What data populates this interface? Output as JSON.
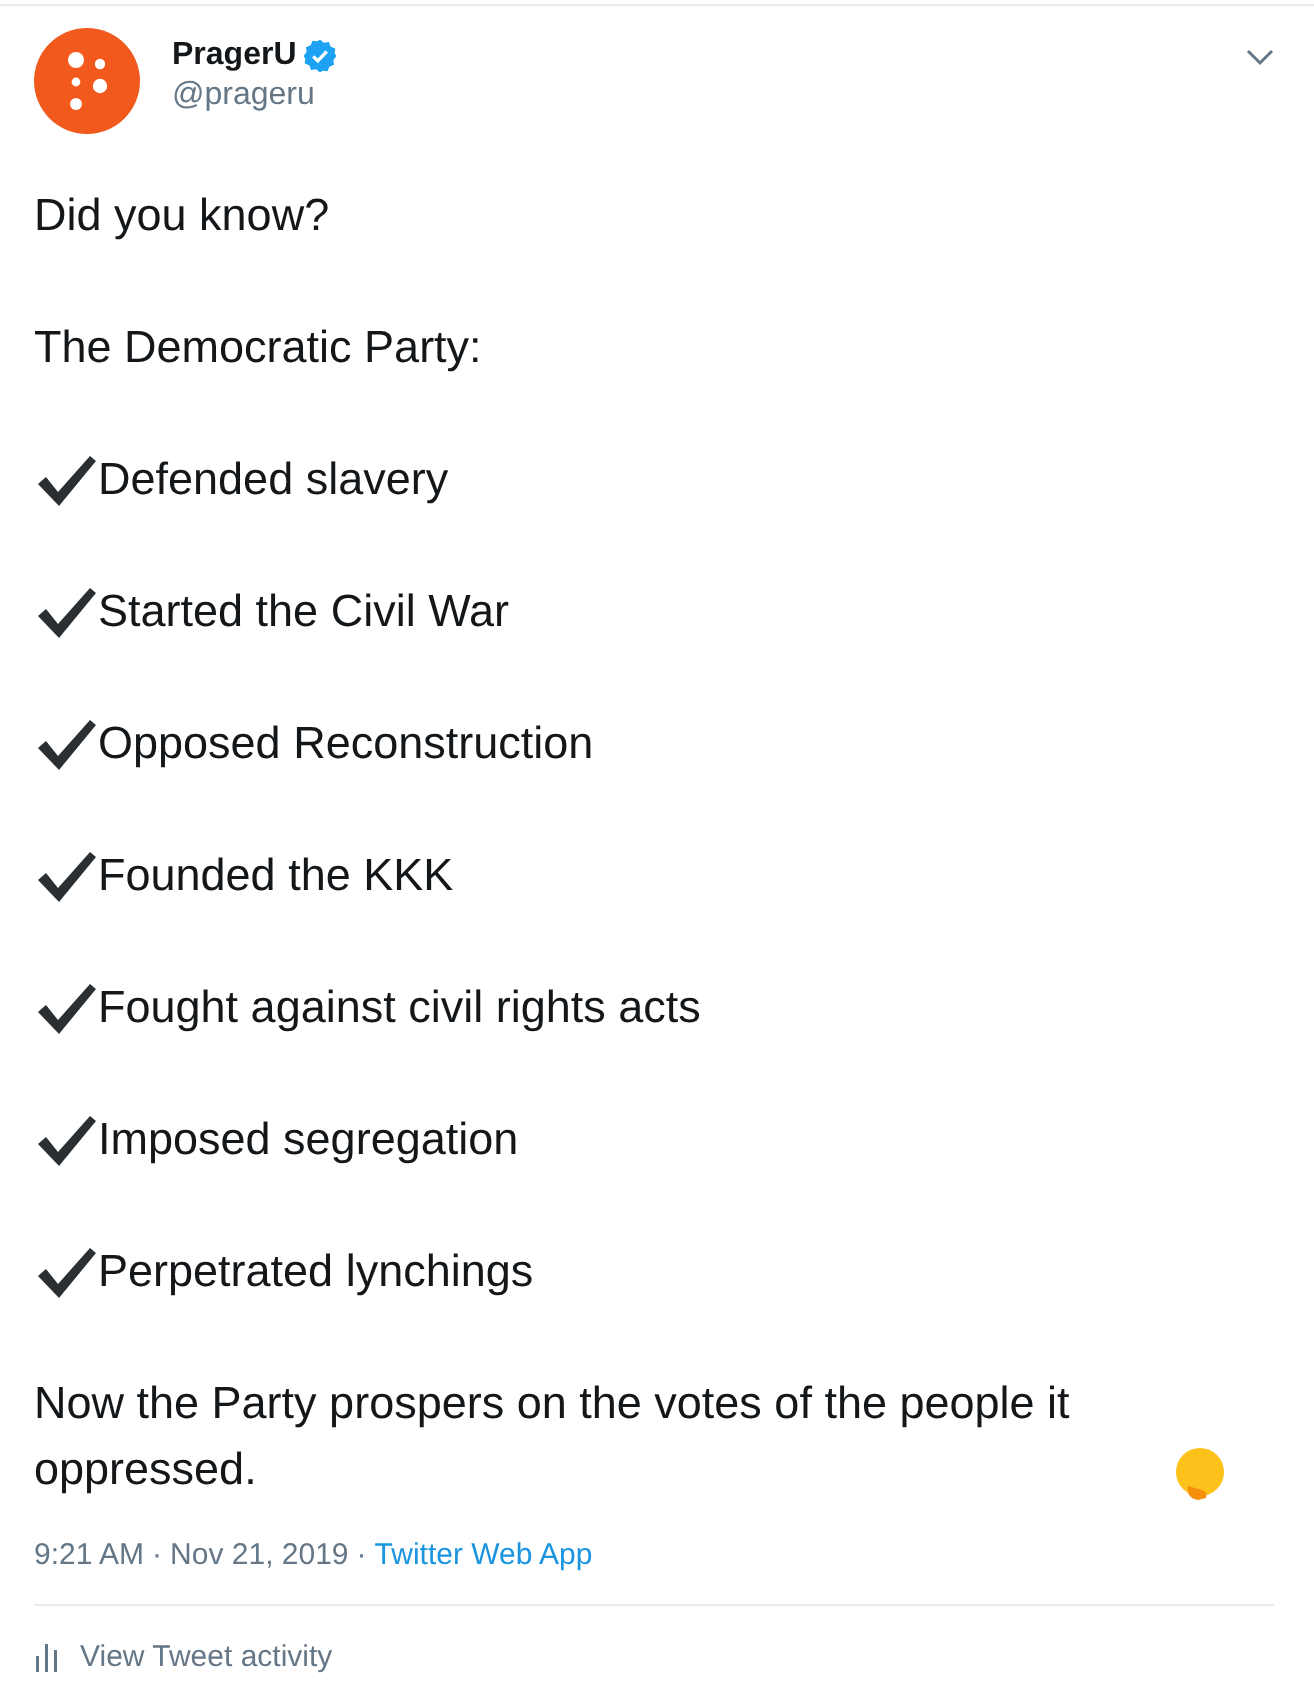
{
  "tweet": {
    "author": {
      "name": "PragerU",
      "verified": true,
      "handle": "@prageru"
    },
    "paragraphs": [
      {
        "kind": "plain",
        "text": "Did you know?"
      },
      {
        "kind": "plain",
        "text": "The Democratic Party:"
      },
      {
        "kind": "check",
        "text": "Defended slavery"
      },
      {
        "kind": "check",
        "text": "Started the Civil War"
      },
      {
        "kind": "check",
        "text": "Opposed Reconstruction"
      },
      {
        "kind": "check",
        "text": "Founded the KKK"
      },
      {
        "kind": "check",
        "text": "Fought against civil rights acts"
      },
      {
        "kind": "check",
        "text": "Imposed segregation"
      },
      {
        "kind": "check",
        "text": "Perpetrated lynchings"
      },
      {
        "kind": "emoji",
        "text": "Now the Party prospers on the votes of the people it oppressed."
      }
    ],
    "time": "9:21 AM",
    "separator_1": "·",
    "date": "Nov 21, 2019",
    "separator_2": "·",
    "source": "Twitter Web App",
    "activity": "View Tweet activity"
  }
}
